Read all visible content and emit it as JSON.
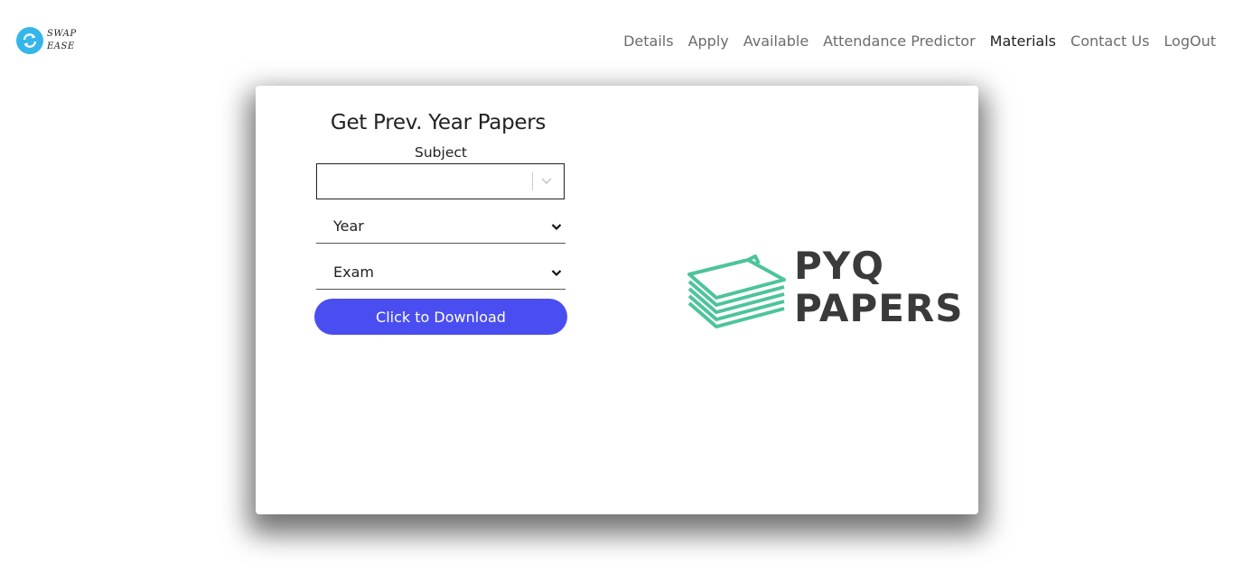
{
  "brand": {
    "logo_line1": "SWAP",
    "logo_line2": "EASE",
    "accent": "#35b6ea"
  },
  "nav": {
    "items": [
      {
        "label": "Details"
      },
      {
        "label": "Apply"
      },
      {
        "label": "Available"
      },
      {
        "label": "Attendance Predictor"
      },
      {
        "label": "Materials",
        "active": true
      },
      {
        "label": "Contact Us"
      },
      {
        "label": "LogOut"
      }
    ]
  },
  "form": {
    "title": "Get Prev. Year Papers",
    "subject_label": "Subject",
    "subject_value": "",
    "year_value": "Year",
    "exam_value": "Exam",
    "download_label": "Click to Download",
    "button_color": "#4a4ef0"
  },
  "banner": {
    "line1": "PYQ",
    "line2": "PAPERS",
    "icon": "paper-stack-icon",
    "icon_color": "#4dc49a"
  }
}
